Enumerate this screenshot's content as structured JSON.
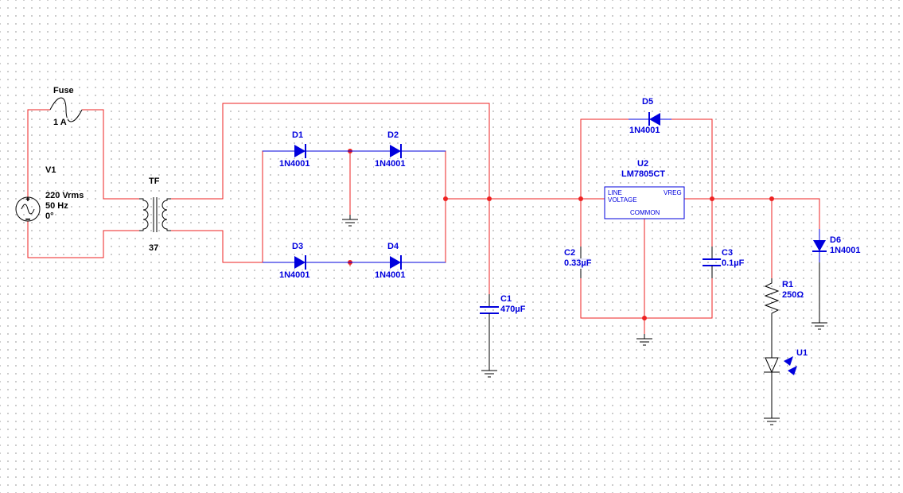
{
  "fuse": {
    "name": "Fuse",
    "rating": "1 A"
  },
  "source": {
    "name": "V1",
    "line1": "220 Vrms",
    "line2": "50 Hz",
    "line3": "0°"
  },
  "xfmr": {
    "name": "TF",
    "ratio": "37"
  },
  "diodes": {
    "d1": {
      "name": "D1",
      "part": "1N4001"
    },
    "d2": {
      "name": "D2",
      "part": "1N4001"
    },
    "d3": {
      "name": "D3",
      "part": "1N4001"
    },
    "d4": {
      "name": "D4",
      "part": "1N4001"
    },
    "d5": {
      "name": "D5",
      "part": "1N4001"
    },
    "d6": {
      "name": "D6",
      "part": "1N4001"
    }
  },
  "caps": {
    "c1": {
      "name": "C1",
      "val": "470µF"
    },
    "c2": {
      "name": "C2",
      "val": "0.33µF"
    },
    "c3": {
      "name": "C3",
      "val": "0.1µF"
    }
  },
  "reg": {
    "name": "U2",
    "part": "LM7805CT",
    "t_in": "LINE",
    "t_in2": "VOLTAGE",
    "t_out": "VREG",
    "t_gnd": "COMMON"
  },
  "res": {
    "name": "R1",
    "val": "250Ω"
  },
  "led": {
    "name": "U1"
  }
}
